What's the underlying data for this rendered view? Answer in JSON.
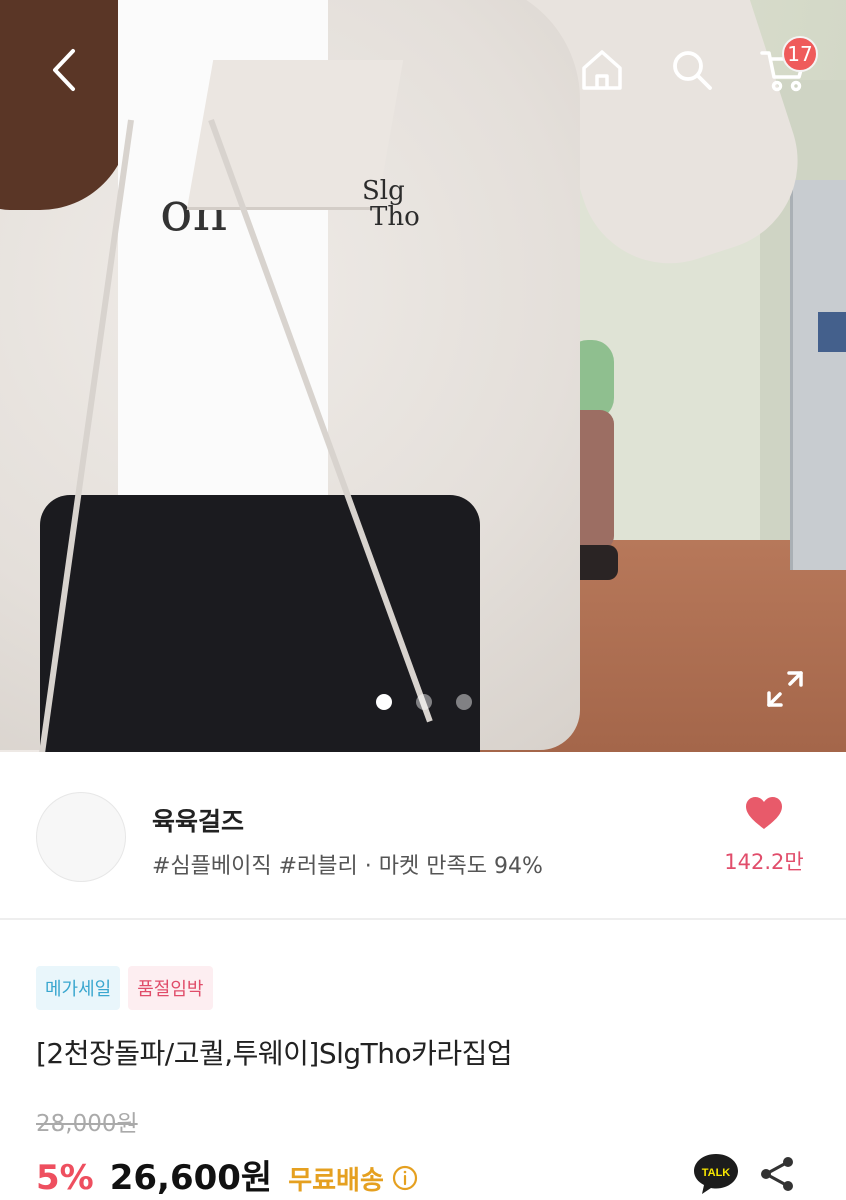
{
  "header": {
    "cart_count": "17"
  },
  "hero": {
    "tee_print": "on",
    "embroidery_line1": "Slg",
    "embroidery_line2": "Tho",
    "carousel_total": 3,
    "carousel_active": 1
  },
  "seller": {
    "name": "육육걸즈",
    "tags": "#심플베이직 #러블리 · 마켓 만족도 94%",
    "like_count": "142.2만"
  },
  "product": {
    "badges": [
      "메가세일",
      "품절임박"
    ],
    "title": "[2천장돌파/고퀄,투웨이]SlgTho카라집업",
    "original_price": "28,000원",
    "discount": "5%",
    "price": "26,600원",
    "shipping": "무료배송",
    "talk_label": "TALK"
  },
  "colors": {
    "accent_red": "#ee4f5f",
    "heart": "#e85a6a",
    "shipping": "#e5a020",
    "mega_badge": "#3aa7cf",
    "sold_badge": "#e04d6a"
  },
  "icons": [
    "back-icon",
    "home-icon",
    "search-icon",
    "cart-icon",
    "expand-icon",
    "heart-icon",
    "info-icon",
    "kakao-talk-icon",
    "share-icon"
  ]
}
